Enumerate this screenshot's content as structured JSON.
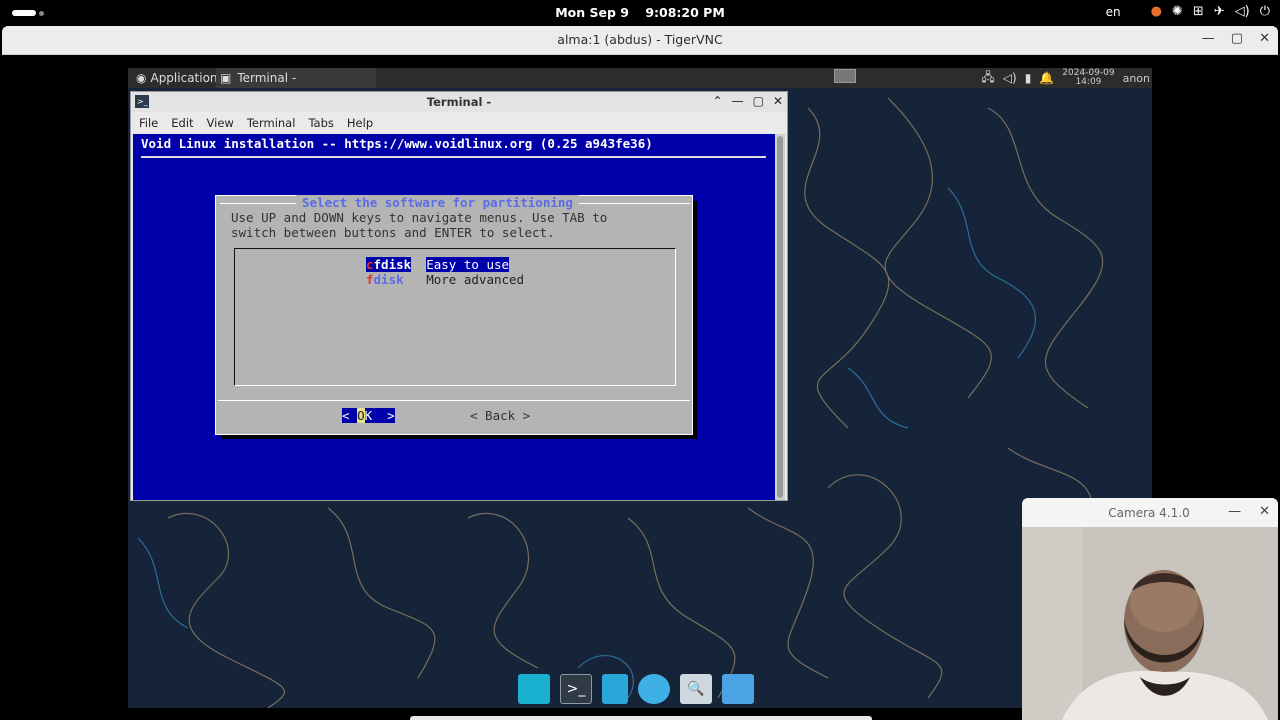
{
  "topbar": {
    "date": "Mon Sep 9",
    "time": "9:08:20 PM",
    "language": "en"
  },
  "vnc": {
    "title": "alma:1 (abdus) - TigerVNC"
  },
  "xfce_panel": {
    "applications_label": "Applications",
    "task_label": "Terminal -",
    "date": "2024-09-09",
    "time": "14:09",
    "user": "anon"
  },
  "terminal": {
    "title": "Terminal -",
    "menu": [
      "File",
      "Edit",
      "View",
      "Terminal",
      "Tabs",
      "Help"
    ],
    "header": "Void Linux installation -- https://www.voidlinux.org (0.25 a943fe36)",
    "dialog": {
      "title": "Select the software for partitioning",
      "instructions_line1": "Use UP and DOWN keys to navigate menus. Use TAB to",
      "instructions_line2": "switch between buttons and ENTER to select.",
      "options": [
        {
          "hotkey": "c",
          "rest": "fdisk",
          "description": "Easy to use",
          "selected": true
        },
        {
          "hotkey": "f",
          "rest": "disk ",
          "description": "More advanced",
          "selected": false
        }
      ],
      "ok_left": "< ",
      "ok_hl": "O",
      "ok_right": "K  >",
      "back_label": "< Back >"
    }
  },
  "camera": {
    "title": "Camera 4.1.0"
  },
  "icons": {
    "close": "close-icon",
    "minimize": "minimize-icon",
    "maximize": "maximize-icon"
  },
  "colors": {
    "dialog_blue": "#0000aa",
    "dialog_gray": "#b4b4b4",
    "title_blue": "#5b6ce8"
  }
}
